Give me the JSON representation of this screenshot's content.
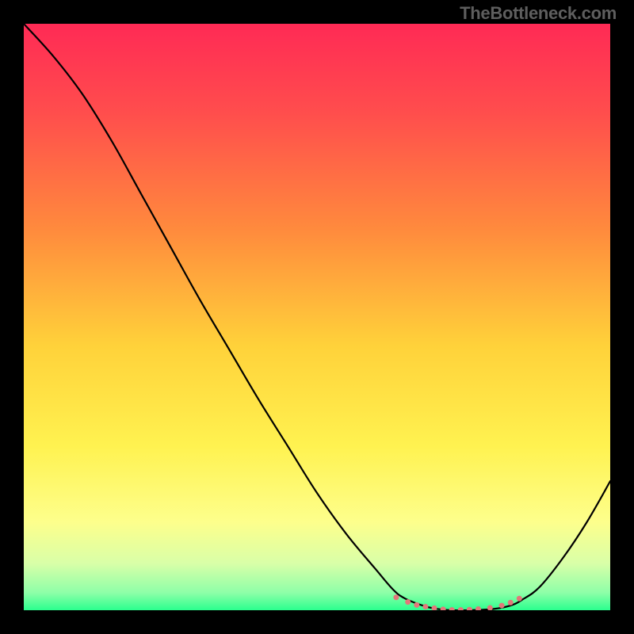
{
  "watermark": "TheBottleneck.com",
  "chart_data": {
    "type": "line",
    "title": "",
    "xlabel": "",
    "ylabel": "",
    "xlim": [
      0,
      100
    ],
    "ylim": [
      0,
      100
    ],
    "background_gradient": {
      "stops": [
        {
          "offset": 0.0,
          "color": "#ff2a55"
        },
        {
          "offset": 0.15,
          "color": "#ff4d4d"
        },
        {
          "offset": 0.35,
          "color": "#ff8a3d"
        },
        {
          "offset": 0.55,
          "color": "#ffd23a"
        },
        {
          "offset": 0.72,
          "color": "#fff250"
        },
        {
          "offset": 0.85,
          "color": "#fdff8c"
        },
        {
          "offset": 0.92,
          "color": "#d9ffa8"
        },
        {
          "offset": 0.97,
          "color": "#8effa8"
        },
        {
          "offset": 1.0,
          "color": "#2bff8e"
        }
      ]
    },
    "series": [
      {
        "name": "bottleneck-curve",
        "color": "#000000",
        "x": [
          0,
          5,
          10,
          15,
          20,
          25,
          30,
          35,
          40,
          45,
          50,
          55,
          60,
          63,
          65,
          68,
          70,
          73,
          76,
          80,
          83,
          85,
          88,
          92,
          96,
          100
        ],
        "y": [
          100,
          94.5,
          88,
          80,
          71,
          62,
          53,
          44.5,
          36,
          28,
          20,
          13,
          7,
          3.5,
          2.0,
          0.8,
          0.3,
          0.0,
          0.0,
          0.2,
          0.8,
          1.8,
          4,
          9,
          15,
          22
        ]
      }
    ],
    "marker_band": {
      "name": "optimal-range-markers",
      "color": "#e2777a",
      "radius": 3.5,
      "x": [
        63.5,
        65.5,
        67.0,
        68.5,
        70.0,
        71.5,
        73.0,
        74.5,
        76.0,
        77.5,
        79.5,
        81.5,
        83.0,
        84.5
      ],
      "y": [
        2.2,
        1.4,
        0.9,
        0.6,
        0.35,
        0.15,
        0.05,
        0.05,
        0.1,
        0.2,
        0.4,
        0.8,
        1.3,
        2.0
      ]
    }
  }
}
